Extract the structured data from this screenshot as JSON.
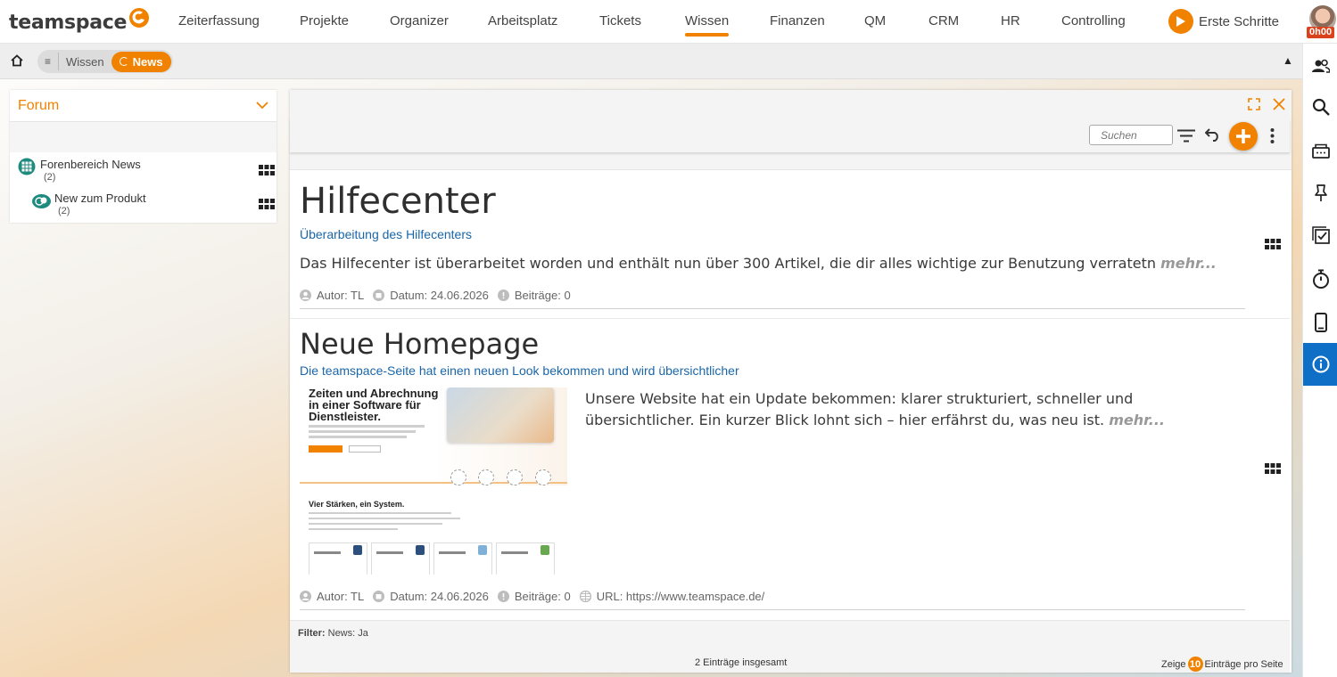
{
  "app": {
    "logo_text": "teamspace"
  },
  "nav": {
    "items": [
      "Zeiterfassung",
      "Projekte",
      "Organizer",
      "Arbeitsplatz",
      "Tickets",
      "Wissen",
      "Finanzen",
      "QM",
      "CRM",
      "HR",
      "Controlling"
    ],
    "active": "Wissen",
    "start_label": "Erste Schritte",
    "timer": "0h00"
  },
  "breadcrumb": {
    "items": [
      "Wissen"
    ],
    "active": "News"
  },
  "forum": {
    "title": "Forum",
    "items": [
      {
        "name": "Forenbereich News",
        "count": "(2)"
      },
      {
        "name": "New zum Produkt",
        "count": "(2)"
      }
    ]
  },
  "main": {
    "search_placeholder": "Suchen",
    "entries": [
      {
        "title": "Hilfecenter",
        "subtitle": "Überarbeitung des Hilfecenters",
        "text": "Das Hilfecenter ist überarbeitet worden und enthält nun über 300 Artikel, die dir alles wichtige zur Benutzung verratetn",
        "more": "mehr...",
        "author": "Autor: TL",
        "date": "Datum: 24.06.2026",
        "posts": "Beiträge: 0"
      },
      {
        "title": "Neue Homepage",
        "subtitle": "Die teamspace-Seite hat einen neuen Look bekommen und wird übersichtlicher",
        "text": "Unsere Website hat ein Update bekommen: klarer strukturiert, schneller und übersichtlicher. Ein kurzer Blick lohnt sich – hier erfährst du, was neu ist.",
        "more": "mehr...",
        "author": "Autor: TL",
        "date": "Datum: 24.06.2026",
        "posts": "Beiträge: 0",
        "url": "URL: https://www.teamspace.de/",
        "thumbnail": {
          "headline": "Zeiten und Abrechnung in einer Software für Dienstleister.",
          "section": "Vier Stärken, ein System."
        }
      }
    ],
    "filter_label": "Filter:",
    "filter_value": "News: Ja",
    "total": "2 Einträge insgesamt",
    "show_prefix": "Zeige",
    "per_page": "10",
    "show_suffix": "Einträge pro Seite"
  },
  "colors": {
    "accent": "#f08200",
    "link": "#1a66a8",
    "rail_active": "#0f6fc6"
  },
  "rail_icons": [
    "users-icon",
    "search-icon",
    "inbox-icon",
    "pin-icon",
    "tasks-icon",
    "stopwatch-icon",
    "mobile-icon",
    "info-icon"
  ]
}
